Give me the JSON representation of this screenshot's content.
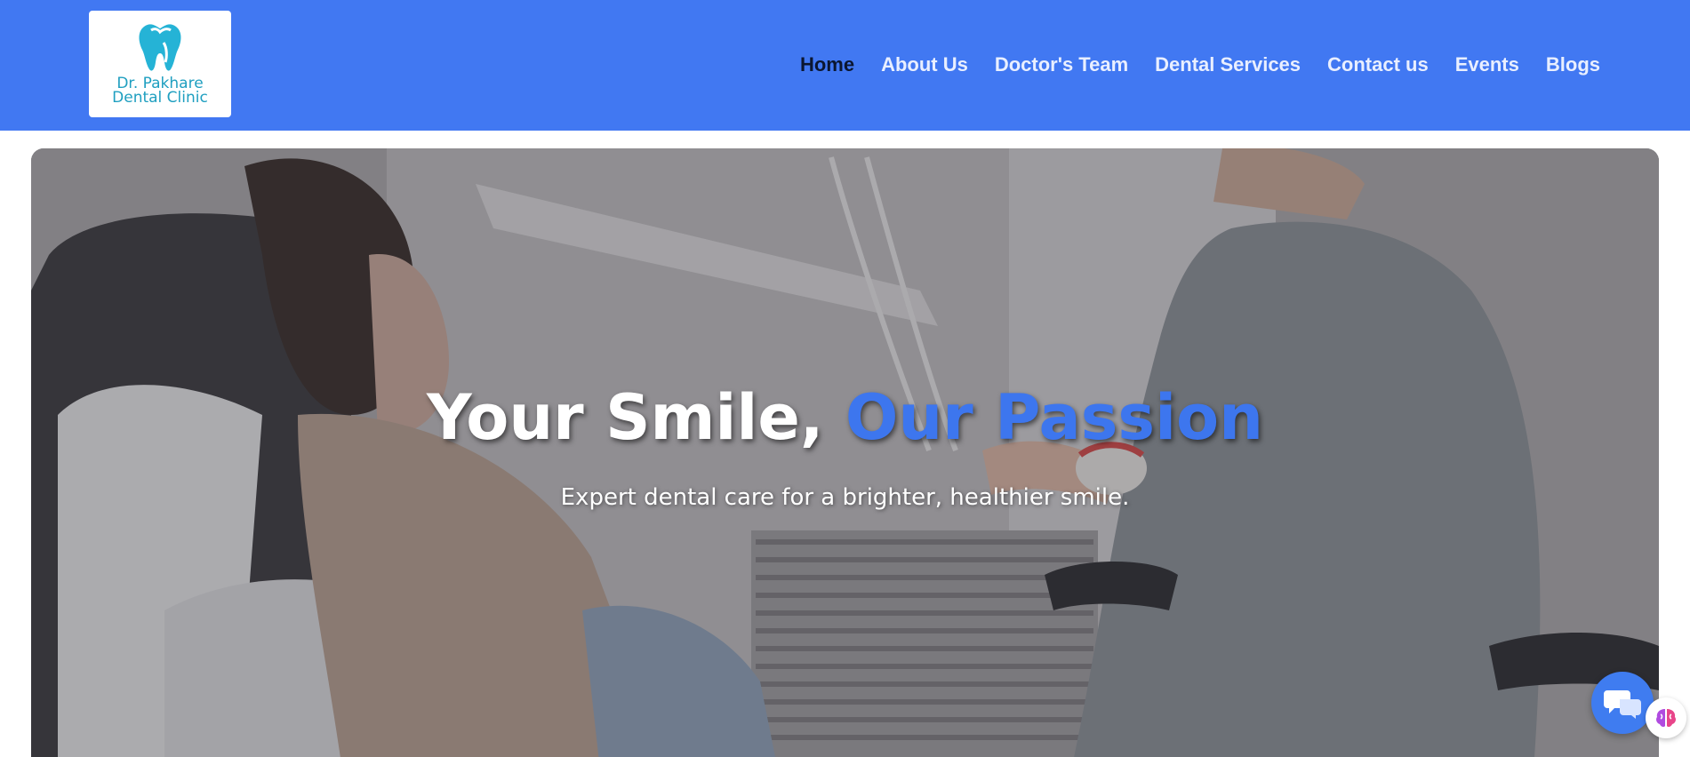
{
  "logo": {
    "line1": "Dr. Pakhare",
    "line2": "Dental Clinic",
    "icon": "tooth-icon"
  },
  "nav": {
    "items": [
      {
        "label": "Home",
        "active": true
      },
      {
        "label": "About Us",
        "active": false
      },
      {
        "label": "Doctor's Team",
        "active": false
      },
      {
        "label": "Dental Services",
        "active": false
      },
      {
        "label": "Contact us",
        "active": false
      },
      {
        "label": "Events",
        "active": false
      },
      {
        "label": "Blogs",
        "active": false
      }
    ]
  },
  "hero": {
    "title_part1": "Your Smile, ",
    "title_accent": "Our Passion",
    "subtitle": "Expert dental care for a brighter, healthier smile."
  },
  "widgets": {
    "chat_icon": "chat-bubbles-icon",
    "ai_icon": "brain-icon"
  },
  "colors": {
    "brand_blue": "#4178f2",
    "accent_blue": "#3d76ee",
    "logo_teal": "#1f9fc0"
  }
}
